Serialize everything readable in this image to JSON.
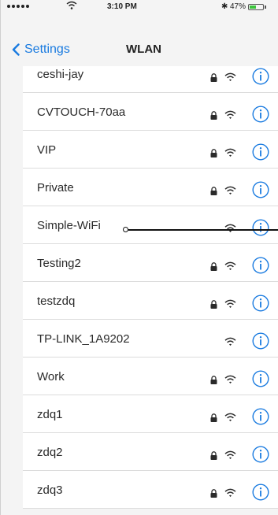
{
  "status_bar": {
    "time": "3:10 PM",
    "battery_text": "47%",
    "bluetooth_glyph": "✱",
    "battery_level": 0.47,
    "signal_dots": 5
  },
  "nav": {
    "back_label": "Settings",
    "title": "WLAN"
  },
  "networks": [
    {
      "name": "ceshi-jay",
      "locked": true
    },
    {
      "name": "CVTOUCH-70aa",
      "locked": true
    },
    {
      "name": "VIP",
      "locked": true
    },
    {
      "name": "Private",
      "locked": true
    },
    {
      "name": "Simple-WiFi",
      "locked": false
    },
    {
      "name": "Testing2",
      "locked": true
    },
    {
      "name": "testzdq",
      "locked": true
    },
    {
      "name": "TP-LINK_1A9202",
      "locked": false
    },
    {
      "name": "Work",
      "locked": true
    },
    {
      "name": "zdq1",
      "locked": true
    },
    {
      "name": "zdq2",
      "locked": true
    },
    {
      "name": "zdq3",
      "locked": true
    }
  ],
  "colors": {
    "accent": "#1a7be0",
    "battery": "#3cc43c"
  },
  "icons": {
    "lock": "lock-icon",
    "wifi": "wifi-icon",
    "info": "info-icon",
    "back": "chevron-left-icon"
  }
}
